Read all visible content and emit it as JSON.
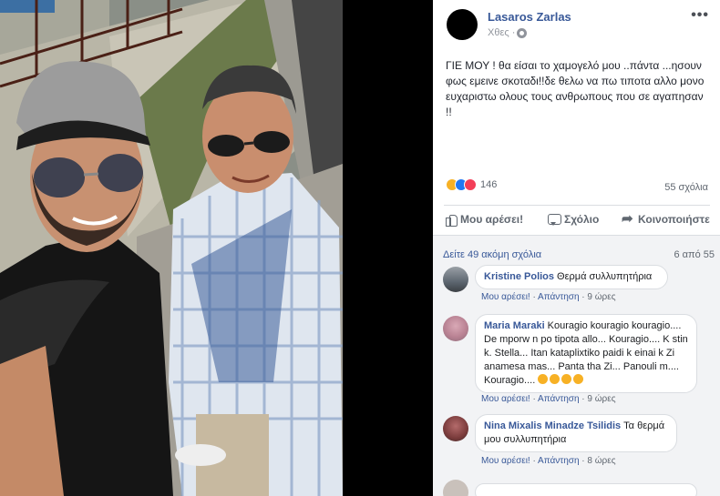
{
  "photo": {
    "alt_icon": "photo-image"
  },
  "post": {
    "author": "Lasaros Zarlas",
    "time": "Χθες ·",
    "text": "ΓΙΕ ΜΟΥ ! θα είσαι το χαμογελό μου ..πάντα ...ησουν φως εμεινε σκοταδι!!δε θελω να πω τιποτα αλλο μονο ευχαριστω ολους τους ανθρωπους που σε αγαπησαν !!",
    "reaction_count": "146",
    "comment_count": "55 σχόλια",
    "more_label": "•••"
  },
  "actions": {
    "like": "Μου αρέσει!",
    "comment": "Σχόλιο",
    "share": "Κοινοποιήστε"
  },
  "comments_section": {
    "view_more": "Δείτε 49 ακόμη σχόλια",
    "pager": "6 από 55"
  },
  "comments": [
    {
      "name": "Kristine Polios",
      "text": "Θερμά συλλυπητήρια",
      "like": "Μου αρέσει!",
      "reply": "Απάντηση",
      "time": "9 ώρες"
    },
    {
      "name": "Maria Maraki",
      "text": "Kouragio kouragio kouragio.... De mporw n po tipota allo... Kouragio.... K stin k. Stella... Itan kataplixtiko paidi k einai k Zi anamesa mas... Panta tha Zi... Panouli m.... Kouragio....",
      "like": "Μου αρέσει!",
      "reply": "Απάντηση",
      "time": "9 ώρες"
    },
    {
      "name": "Nina Mixalis Minadze Tsilidis",
      "text": "Τα θερμά μου συλλυπητήρια",
      "like": "Μου αρέσει!",
      "reply": "Απάντηση",
      "time": "8 ώρες"
    }
  ],
  "colors": {
    "link": "#385898",
    "muted": "#606770",
    "panel_bg": "#f2f3f5"
  }
}
